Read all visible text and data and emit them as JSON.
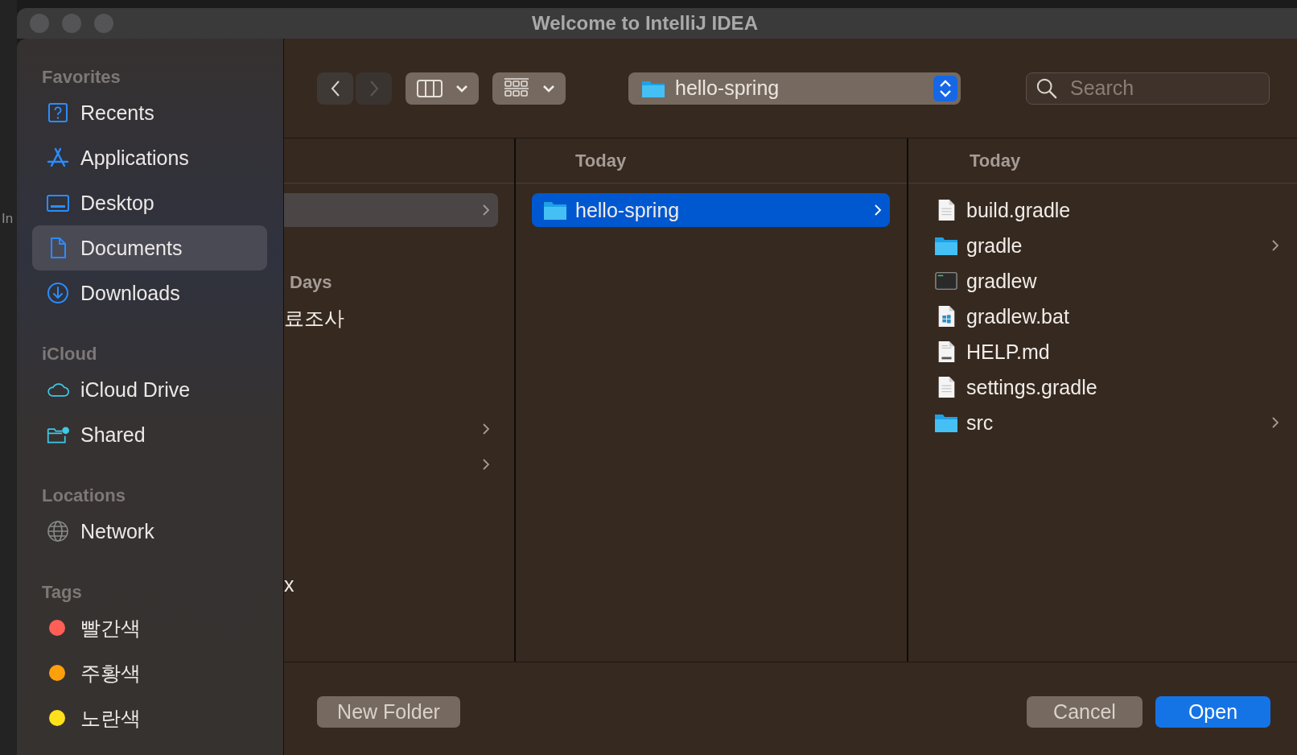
{
  "window": {
    "title": "Welcome to IntelliJ IDEA"
  },
  "background": {
    "partial_label": "In"
  },
  "sidebar": {
    "sections": [
      {
        "heading": "Favorites",
        "items": [
          {
            "kind": "recents",
            "label": "Recents",
            "selected": false
          },
          {
            "kind": "applications",
            "label": "Applications",
            "selected": false
          },
          {
            "kind": "desktop",
            "label": "Desktop",
            "selected": false
          },
          {
            "kind": "documents",
            "label": "Documents",
            "selected": true
          },
          {
            "kind": "downloads",
            "label": "Downloads",
            "selected": false
          }
        ]
      },
      {
        "heading": "iCloud",
        "items": [
          {
            "kind": "icloud",
            "label": "iCloud Drive",
            "selected": false
          },
          {
            "kind": "shared",
            "label": "Shared",
            "selected": false
          }
        ]
      },
      {
        "heading": "Locations",
        "items": [
          {
            "kind": "network",
            "label": "Network",
            "selected": false
          }
        ]
      },
      {
        "heading": "Tags",
        "items": [
          {
            "kind": "tag",
            "label": "빨간색",
            "selected": false,
            "color": "#ff5f57"
          },
          {
            "kind": "tag",
            "label": "주황색",
            "selected": false,
            "color": "#ffa00a"
          },
          {
            "kind": "tag",
            "label": "노란색",
            "selected": false,
            "color": "#ffe01a"
          }
        ]
      }
    ]
  },
  "toolbar": {
    "nav": [
      {
        "kind": "back",
        "disabled": false
      },
      {
        "kind": "forward",
        "disabled": true
      }
    ],
    "view_buttons": [
      {
        "kind": "columns"
      },
      {
        "kind": "icons"
      }
    ],
    "path": "hello-spring",
    "search": {
      "placeholder": "Search"
    }
  },
  "columns": [
    {
      "focused": false,
      "items": [
        {
          "kind": "entry",
          "selected": true,
          "has_children": true
        },
        {
          "kind": "heading",
          "name": "Days",
          "selected": false,
          "has_children": false
        },
        {
          "kind": "entry",
          "name": "료조사",
          "selected": false,
          "has_children": false
        },
        {
          "kind": "entry",
          "selected": false,
          "has_children": true
        },
        {
          "kind": "entry",
          "selected": false,
          "has_children": true
        },
        {
          "kind": "entry",
          "name": "x",
          "selected": false,
          "has_children": false
        }
      ]
    },
    {
      "heading": "Today",
      "focused": true,
      "items": [
        {
          "kind": "folder",
          "name": "hello-spring",
          "selected": true,
          "has_children": true
        }
      ]
    },
    {
      "heading": "Today",
      "focused": false,
      "items": [
        {
          "kind": "doc",
          "name": "build.gradle",
          "selected": false,
          "has_children": false
        },
        {
          "kind": "folder",
          "name": "gradle",
          "selected": false,
          "has_children": true
        },
        {
          "kind": "terminal",
          "name": "gradlew",
          "selected": false,
          "has_children": false
        },
        {
          "kind": "windows-doc",
          "name": "gradlew.bat",
          "selected": false,
          "has_children": false
        },
        {
          "kind": "md-doc",
          "name": "HELP.md",
          "selected": false,
          "has_children": false
        },
        {
          "kind": "doc",
          "name": "settings.gradle",
          "selected": false,
          "has_children": false
        },
        {
          "kind": "folder",
          "name": "src",
          "selected": false,
          "has_children": true
        }
      ]
    }
  ],
  "buttons": [
    {
      "kind": "secondary",
      "label": "New Folder"
    },
    {
      "kind": "secondary",
      "label": "Cancel"
    },
    {
      "kind": "primary",
      "label": "Open"
    }
  ]
}
